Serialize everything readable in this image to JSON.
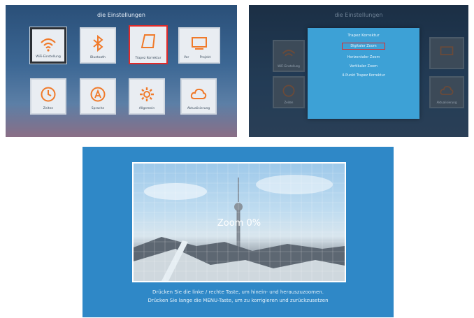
{
  "settings": {
    "title": "die Einstellungen",
    "tiles": [
      {
        "label": "WiFi-Einstellung",
        "icon": "wifi-icon"
      },
      {
        "label": "Bluetooth",
        "icon": "bluetooth-icon"
      },
      {
        "label": "Trapez Korrektur",
        "icon": "keystone-icon"
      },
      {
        "label": "Vor",
        "icon": "projector-icon"
      },
      {
        "label": "Projekt",
        "icon": ""
      },
      {
        "label": "Zeiten",
        "icon": "clock-icon"
      },
      {
        "label": "Sprache",
        "icon": "language-icon"
      },
      {
        "label": "Allgemein",
        "icon": "gear-icon"
      },
      {
        "label": "Aktualisierung",
        "icon": "cloud-icon"
      }
    ]
  },
  "dialog_screen": {
    "title": "die Einstellungen",
    "menu": [
      "Trapez Korrektur",
      "Digitaler Zoom",
      "Horizontaler Zoom",
      "Vertikaler Zoom",
      "4-Punkt Trapez Korrektur"
    ],
    "selected": "Digitaler Zoom",
    "bg_tiles": [
      "WiFi-Einstellung",
      "Zeiten",
      "Aktualisierung"
    ]
  },
  "zoom_screen": {
    "zoom_label": "Zoom 0%",
    "hint_line1": "Drücken Sie die linke / rechte Taste, um hinein- und herauszuzoomen.",
    "hint_line2": "Drücken Sie lange die MENU-Taste, um zu korrigieren und zurückzusetzen"
  },
  "colors": {
    "accent_orange": "#f07a2a",
    "selection_red": "#e02a2a",
    "dialog_blue": "#3da1d6"
  }
}
